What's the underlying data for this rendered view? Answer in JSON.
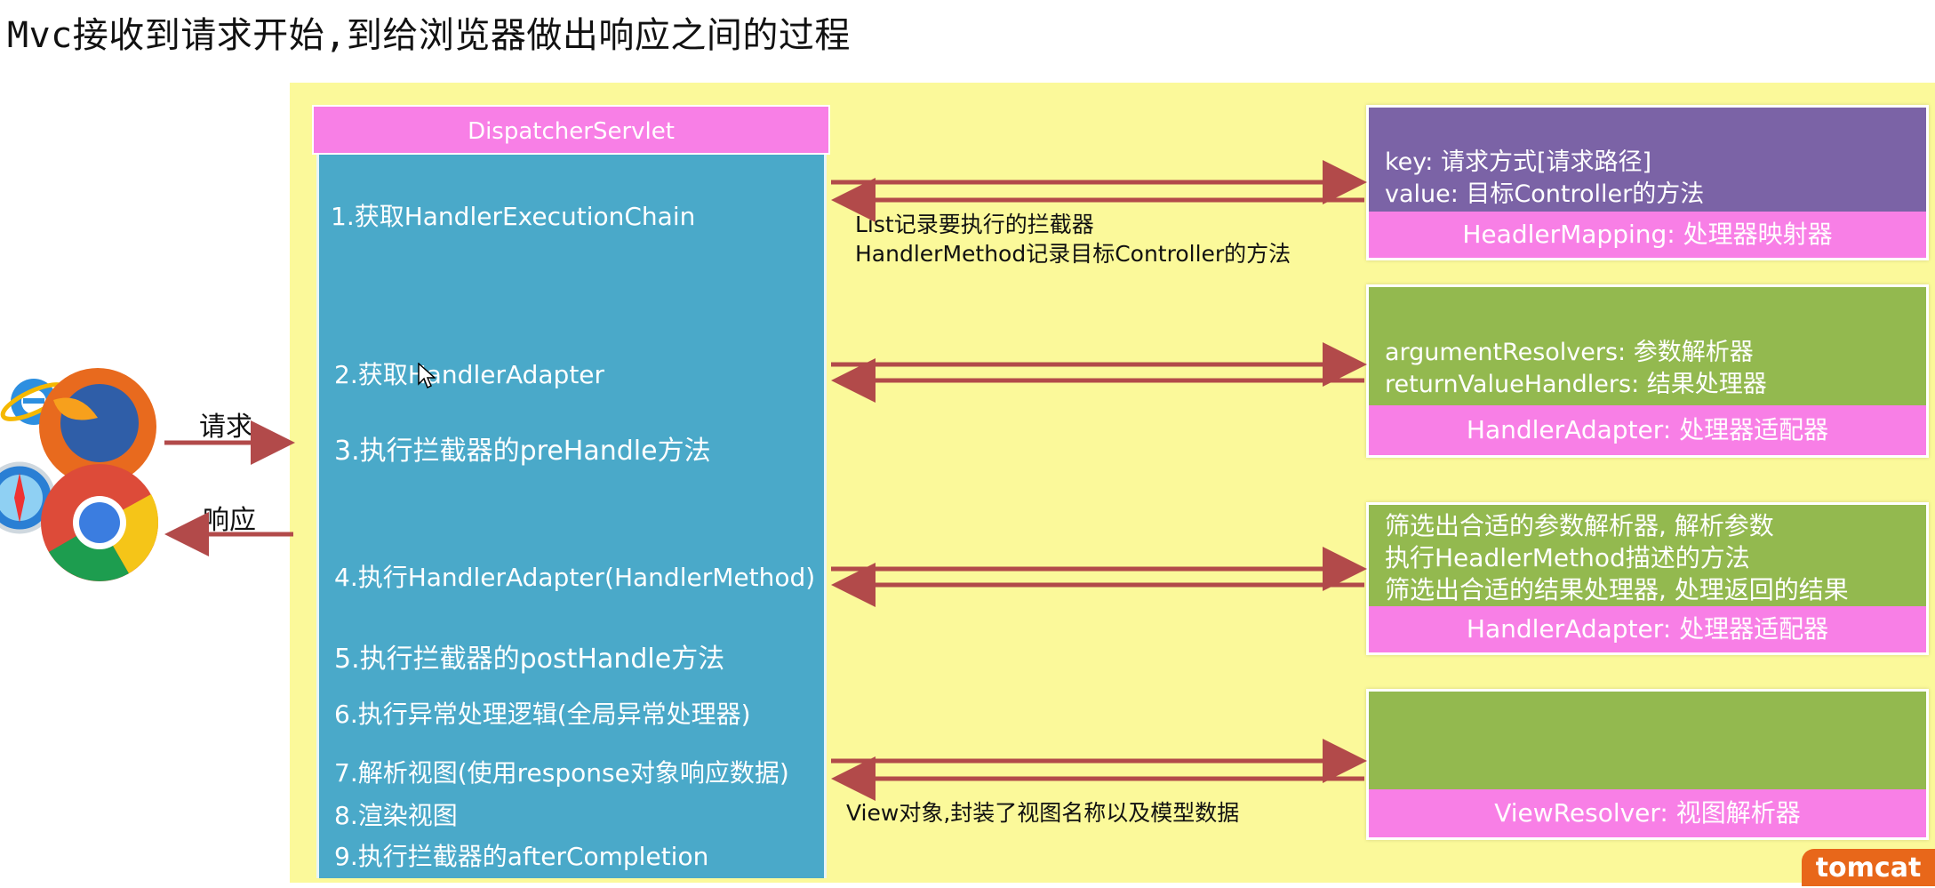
{
  "title": "Mvc接收到请求开始,到给浏览器做出响应之间的过程",
  "dispatcher": {
    "header": "DispatcherServlet",
    "steps": [
      "1.获取HandlerExecutionChain",
      "2.获取HandlerAdapter",
      "3.执行拦截器的preHandle方法",
      "4.执行HandlerAdapter(HandlerMethod)",
      "5.执行拦截器的postHandle方法",
      "6.执行异常处理逻辑(全局异常处理器)",
      "7.解析视图(使用response对象响应数据)",
      "8.渲染视图",
      "9.执行拦截器的afterCompletion"
    ]
  },
  "arrow_notes": {
    "mapping_note_1": "List记录要执行的拦截器",
    "mapping_note_2": "HandlerMethod记录目标Controller的方法",
    "view_note": "View对象,封装了视图名称以及模型数据"
  },
  "boxes": {
    "mapping": {
      "lines": [
        "key:  请求方式[请求路径]",
        "value: 目标Controller的方法"
      ],
      "label": "HeadlerMapping: 处理器映射器",
      "color": "#7b63a6"
    },
    "adapter1": {
      "lines": [
        "argumentResolvers:  参数解析器",
        "returnValueHandlers: 结果处理器"
      ],
      "label": "HandlerAdapter: 处理器适配器",
      "color": "#93b94f"
    },
    "adapter2": {
      "lines": [
        "筛选出合适的参数解析器, 解析参数",
        "执行HeadlerMethod描述的方法",
        "筛选出合适的结果处理器, 处理返回的结果"
      ],
      "label": "HandlerAdapter: 处理器适配器",
      "color": "#93b94f"
    },
    "resolver": {
      "lines": [],
      "label": "ViewResolver: 视图解析器",
      "color": "#93b94f"
    }
  },
  "browser": {
    "request_label": "请求",
    "response_label": "响应",
    "icons": [
      "ie-icon",
      "firefox-icon",
      "safari-icon",
      "chrome-icon"
    ]
  },
  "footer": {
    "brand": "tomcat"
  },
  "colors": {
    "pink": "#f87fe6",
    "blue": "#4aa9c9",
    "yellow": "#fbf99a",
    "arrow": "#b24a4a"
  }
}
